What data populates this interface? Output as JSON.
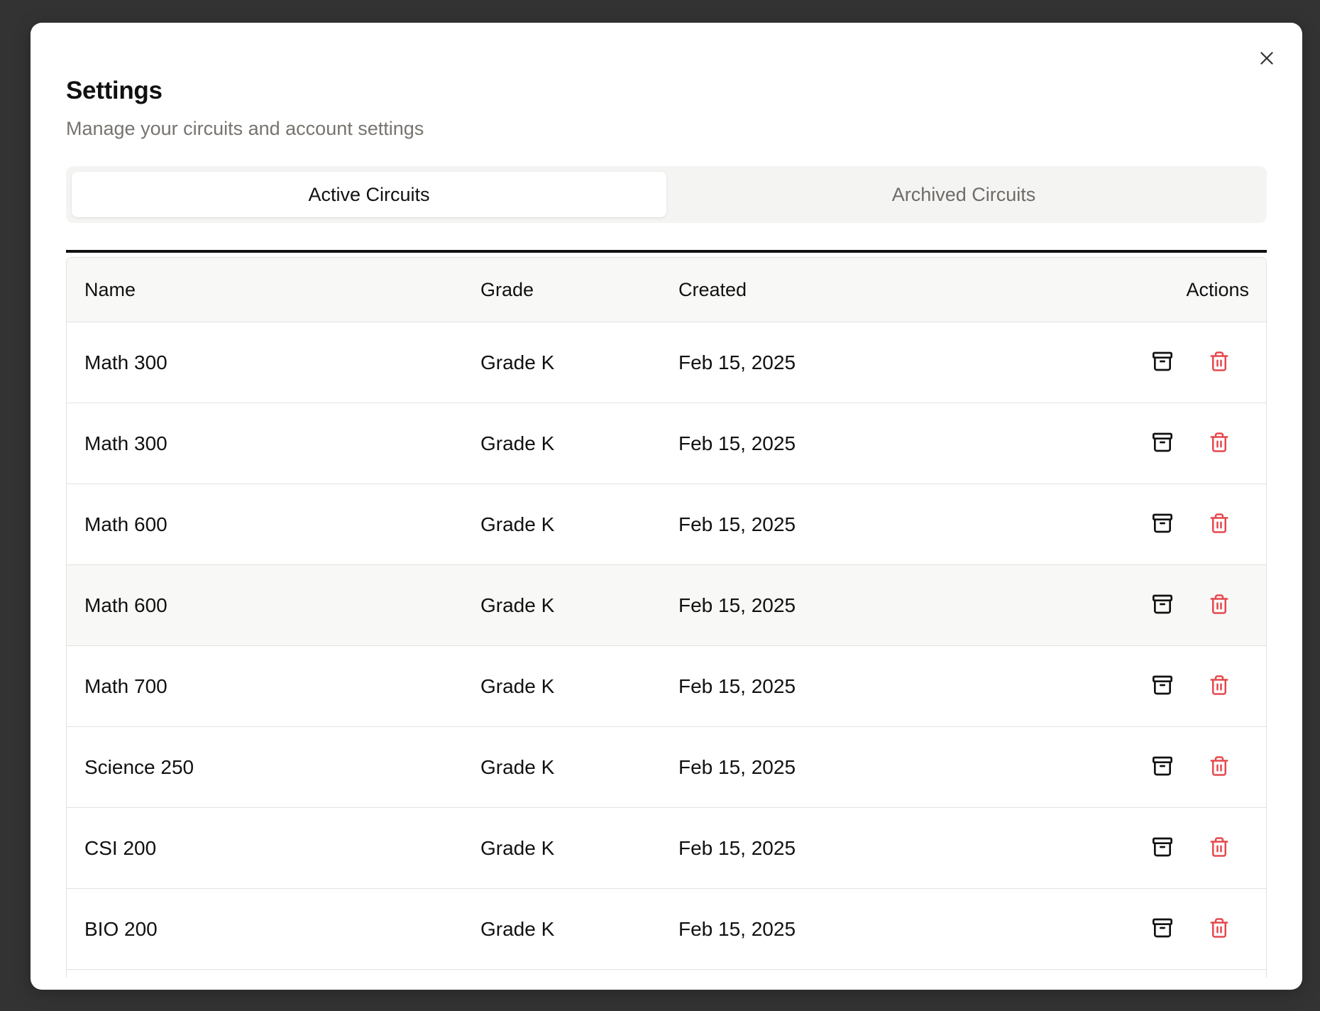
{
  "dialog": {
    "title": "Settings",
    "subtitle": "Manage your circuits and account settings",
    "close_icon": "close-icon"
  },
  "tabs": [
    {
      "label": "Active Circuits",
      "active": true
    },
    {
      "label": "Archived Circuits",
      "active": false
    }
  ],
  "table": {
    "columns": [
      "Name",
      "Grade",
      "Created",
      "Actions"
    ],
    "rows": [
      {
        "name": "Math 300",
        "grade": "Grade K",
        "created": "Feb 15, 2025"
      },
      {
        "name": "Math 300",
        "grade": "Grade K",
        "created": "Feb 15, 2025"
      },
      {
        "name": "Math 600",
        "grade": "Grade K",
        "created": "Feb 15, 2025"
      },
      {
        "name": "Math 600",
        "grade": "Grade K",
        "created": "Feb 15, 2025"
      },
      {
        "name": "Math 700",
        "grade": "Grade K",
        "created": "Feb 15, 2025"
      },
      {
        "name": "Science 250",
        "grade": "Grade K",
        "created": "Feb 15, 2025"
      },
      {
        "name": "CSI 200",
        "grade": "Grade K",
        "created": "Feb 15, 2025"
      },
      {
        "name": "BIO 200",
        "grade": "Grade K",
        "created": "Feb 15, 2025"
      }
    ],
    "row_actions": [
      "archive-icon",
      "trash-icon"
    ]
  },
  "colors": {
    "backdrop": "#333333",
    "delete": "#e5484d",
    "muted_text": "#77736f",
    "tab_track": "#f4f4f3"
  }
}
